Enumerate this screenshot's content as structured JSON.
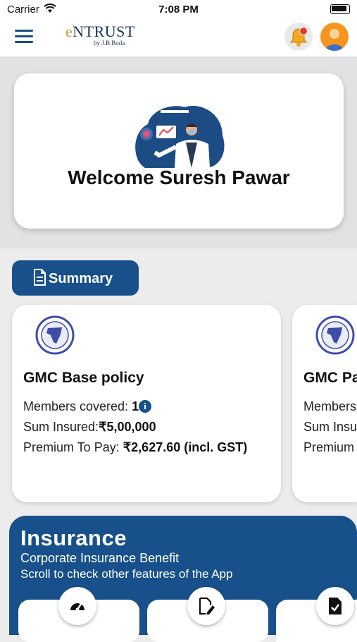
{
  "status_bar": {
    "carrier": "Carrier",
    "time": "7:08 PM"
  },
  "header": {
    "brand_prefix": "e",
    "brand_name": "NTRUST",
    "brand_tagline": "by J.B.Boda",
    "menu_icon": "hamburger-icon",
    "notification_icon": "bell-icon",
    "avatar_icon": "user-avatar-icon"
  },
  "welcome": {
    "message": "Welcome Suresh Pawar",
    "illustration": "doctor-illustration"
  },
  "summary_button": {
    "label": "Summary",
    "icon": "document-icon"
  },
  "policies": [
    {
      "title": "GMC Base policy",
      "members_label": "Members covered: ",
      "members_value": "1",
      "sum_label": "Sum Insured:",
      "sum_value": "₹5,00,000",
      "premium_label": "Premium To Pay: ",
      "premium_value": "₹2,627.60 (incl. GST)"
    },
    {
      "title": "GMC Pa",
      "members_label": "Members",
      "sum_label": "Sum Insu",
      "premium_label": "Premium"
    }
  ],
  "insurance": {
    "title": "Insurance",
    "subtitle": "Corporate Insurance Benefit",
    "hint": "Scroll to check other features of the App",
    "features": [
      {
        "icon": "speedometer-icon"
      },
      {
        "icon": "edit-document-icon"
      },
      {
        "icon": "checked-document-icon"
      }
    ]
  },
  "colors": {
    "primary": "#17508a",
    "brand_gold": "#c59a2a",
    "notification_dot": "#e23b2e",
    "avatar_bg": "#f7941e"
  }
}
